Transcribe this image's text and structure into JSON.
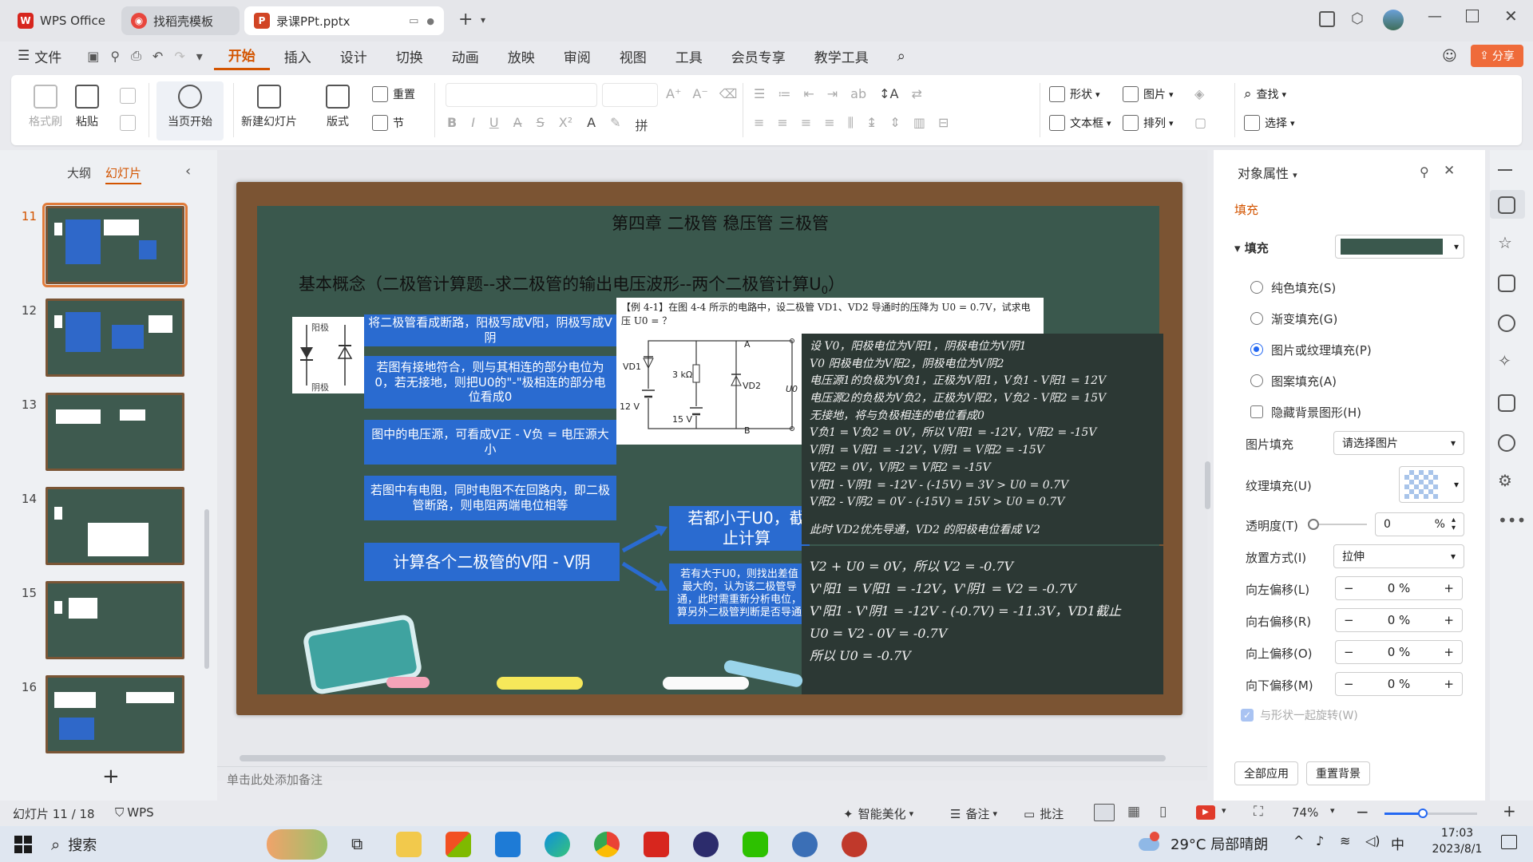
{
  "tabs": [
    {
      "label": "WPS Office"
    },
    {
      "label": "找稻壳模板"
    },
    {
      "label": "录课PPt.pptx"
    }
  ],
  "menu": [
    "文件",
    "开始",
    "插入",
    "设计",
    "切换",
    "动画",
    "放映",
    "审阅",
    "视图",
    "工具",
    "会员专享",
    "教学工具"
  ],
  "share_label": "分享",
  "ribbon": {
    "format_painter": "格式刷",
    "paste": "粘贴",
    "play_from_current": "当页开始",
    "new_slide": "新建幻灯片",
    "layout": "版式",
    "section": "节",
    "reset": "重置",
    "shape": "形状",
    "picture": "图片",
    "textbox": "文本框",
    "arrange": "排列",
    "find": "查找",
    "select": "选择"
  },
  "left_panel": {
    "outline_tab": "大纲",
    "slides_tab": "幻灯片",
    "slide_numbers": [
      "11",
      "12",
      "13",
      "14",
      "15",
      "16"
    ],
    "add_symbol": "+"
  },
  "slide": {
    "chapter_title": "第四章 二极管 稳压管 三极管",
    "heading": "基本概念（二极管计算题--求二极管的输出电压波形--两个二极管计算U",
    "heading_sub": "0",
    "heading_end": "）",
    "anode_label": "阳极",
    "cathode_label": "阴极",
    "box1": "将二极管看成断路，阳极写成V阳，阴极写成V阴",
    "box2": "若图有接地符合，则与其相连的部分电位为0，若无接地，则把U0的\"-\"极相连的部分电位看成0",
    "box3": "图中的电压源，可看成V正 - V负 = 电压源大小",
    "box4": "若图中有电阻，同时电阻不在回路内，即二极管断路，则电阻两端电位相等",
    "box5": "计算各个二极管的V阳 - V阴",
    "box6": "若都小于U0，截止计算",
    "box7": "若有大于U0，则找出差值最大的，认为该二极管导通，此时需重新分析电位，算另外二极管判断是否导通",
    "example_text": "【例 4-1】在图 4-4 所示的电路中，设二极管 VD1、VD2 导通时的压降为 U0 = 0.7V，试求电压 U0 = ？",
    "circuit": {
      "vd1": "VD1",
      "vd2": "VD2",
      "r": "3 kΩ",
      "v12": "12 V",
      "v15": "15 V",
      "a": "A",
      "b": "B",
      "uo": "U0"
    },
    "note_top": [
      "设 V0，阳极电位为V阳1，阴极电位为V阴1",
      "V0 阳极电位为V阳2，阴极电位为V阴2",
      "电压源1的负极为V负1，正极为V阳1，V负1 - V阳1 = 12V",
      "电压源2的负极为V负2，正极为V阳2，V负2 - V阳2 = 15V",
      "无接地，将与负极相连的电位看成0",
      "V负1 = V负2 = 0V，所以 V阳1 = -12V，V阳2 = -15V",
      "V阴1 = V阳1 = -12V，V阴1 = V阳2 = -15V",
      "V阳2 = 0V，V阴2 = V阳2 = -15V",
      "V阳1 - V阴1 = -12V - (-15V) = 3V > U0 = 0.7V",
      "V阳2 - V阴2 = 0V - (-15V) = 15V > U0 = 0.7V"
    ],
    "note_mid": "此时 VD2优先导通，VD2 的阳极电位看成 V2",
    "note_bottom": [
      "V2 + U0 = 0V，所以 V2 = -0.7V",
      "V'阳1 = V阳1 = -12V，V'阴1 = V2 = -0.7V",
      "V'阳1 - V'阴1 = -12V - (-0.7V) = -11.3V，VD1截止",
      "U0 = V2 - 0V = -0.7V",
      "所以 U0 = -0.7V"
    ]
  },
  "notes_placeholder": "单击此处添加备注",
  "right_panel": {
    "title": "对象属性",
    "fill_tab": "填充",
    "fill_section": "填充",
    "fill_color": "#3a584d",
    "options": [
      "纯色填充(S)",
      "渐变填充(G)",
      "图片或纹理填充(P)",
      "图案填充(A)"
    ],
    "hide_bg": "隐藏背景图形(H)",
    "picture_fill_label": "图片填充",
    "picture_fill_value": "请选择图片",
    "texture_label": "纹理填充(U)",
    "transparency_label": "透明度(T)",
    "transparency_value": "0",
    "transparency_unit": "%",
    "placement_label": "放置方式(I)",
    "placement_value": "拉伸",
    "offset_left_label": "向左偏移(L)",
    "offset_right_label": "向右偏移(R)",
    "offset_up_label": "向上偏移(O)",
    "offset_down_label": "向下偏移(M)",
    "offset_value": "0 %",
    "rotate_with_shape": "与形状一起旋转(W)",
    "apply_all": "全部应用",
    "reset_bg": "重置背景"
  },
  "status": {
    "slide_info": "幻灯片 11 / 18",
    "wps": "WPS",
    "beautify": "智能美化",
    "notes": "备注",
    "comment": "批注",
    "zoom": "74%"
  },
  "taskbar": {
    "search": "搜索",
    "weather": "29°C 局部晴朗",
    "ime": "中",
    "time": "17:03",
    "date": "2023/8/1"
  }
}
